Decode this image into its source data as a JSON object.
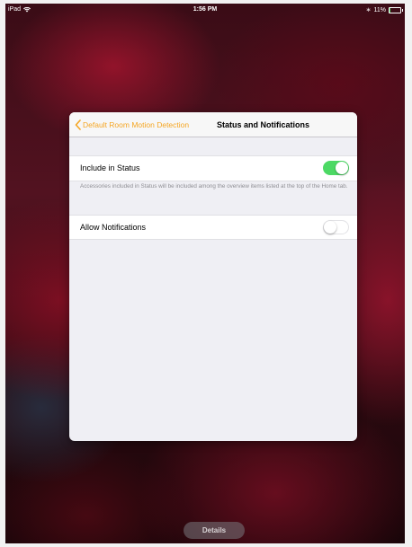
{
  "status_bar": {
    "device": "iPad",
    "time": "1:56 PM",
    "battery_text": "11%",
    "battery_level": 0.11
  },
  "sheet": {
    "back_label": "Default Room Motion Detection",
    "title": "Status and Notifications",
    "include_in_status": {
      "label": "Include in Status",
      "enabled": true
    },
    "footnote": "Accessories included in Status will be included among the overview items listed at the top of the Home tab.",
    "allow_notifications": {
      "label": "Allow Notifications",
      "enabled": false
    }
  },
  "details_button": "Details",
  "colors": {
    "accent": "#f5a623",
    "toggle_on": "#4cd964"
  }
}
